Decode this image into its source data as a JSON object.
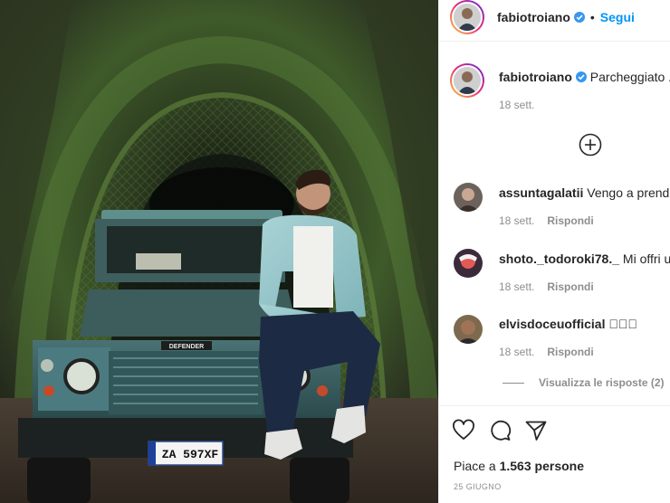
{
  "post": {
    "author": "fabiotroiano",
    "follow_label": "Segui",
    "caption": "Parcheggiato .",
    "caption_time": "18 sett.",
    "likes_prefix": "Piace a ",
    "likes_count": "1.563",
    "likes_suffix": " persone",
    "date": "25 GIUGNO"
  },
  "photo": {
    "plate": "ZA 597XF",
    "grille_badge": "DEFENDER"
  },
  "comments": [
    {
      "user": "assuntagalatii",
      "text": "Vengo a prendere",
      "time": "18 sett.",
      "reply": "Rispondi"
    },
    {
      "user": "shoto._todoroki78._",
      "text": "Mi offri un",
      "time": "18 sett.",
      "reply": "Rispondi"
    },
    {
      "user": "elvisdoceuofficial",
      "text": "󾓦󾓦🌢",
      "time": "18 sett.",
      "reply": "Rispondi"
    }
  ],
  "view_replies": "Visualizza le risposte (2)",
  "icons": {
    "verified": "verified-badge-icon",
    "load_more": "plus-circle-icon",
    "like": "heart-icon",
    "comment": "comment-bubble-icon",
    "share": "paper-plane-icon"
  },
  "colors": {
    "link": "#0095f6",
    "muted": "#8e8e8e",
    "text": "#262626"
  }
}
